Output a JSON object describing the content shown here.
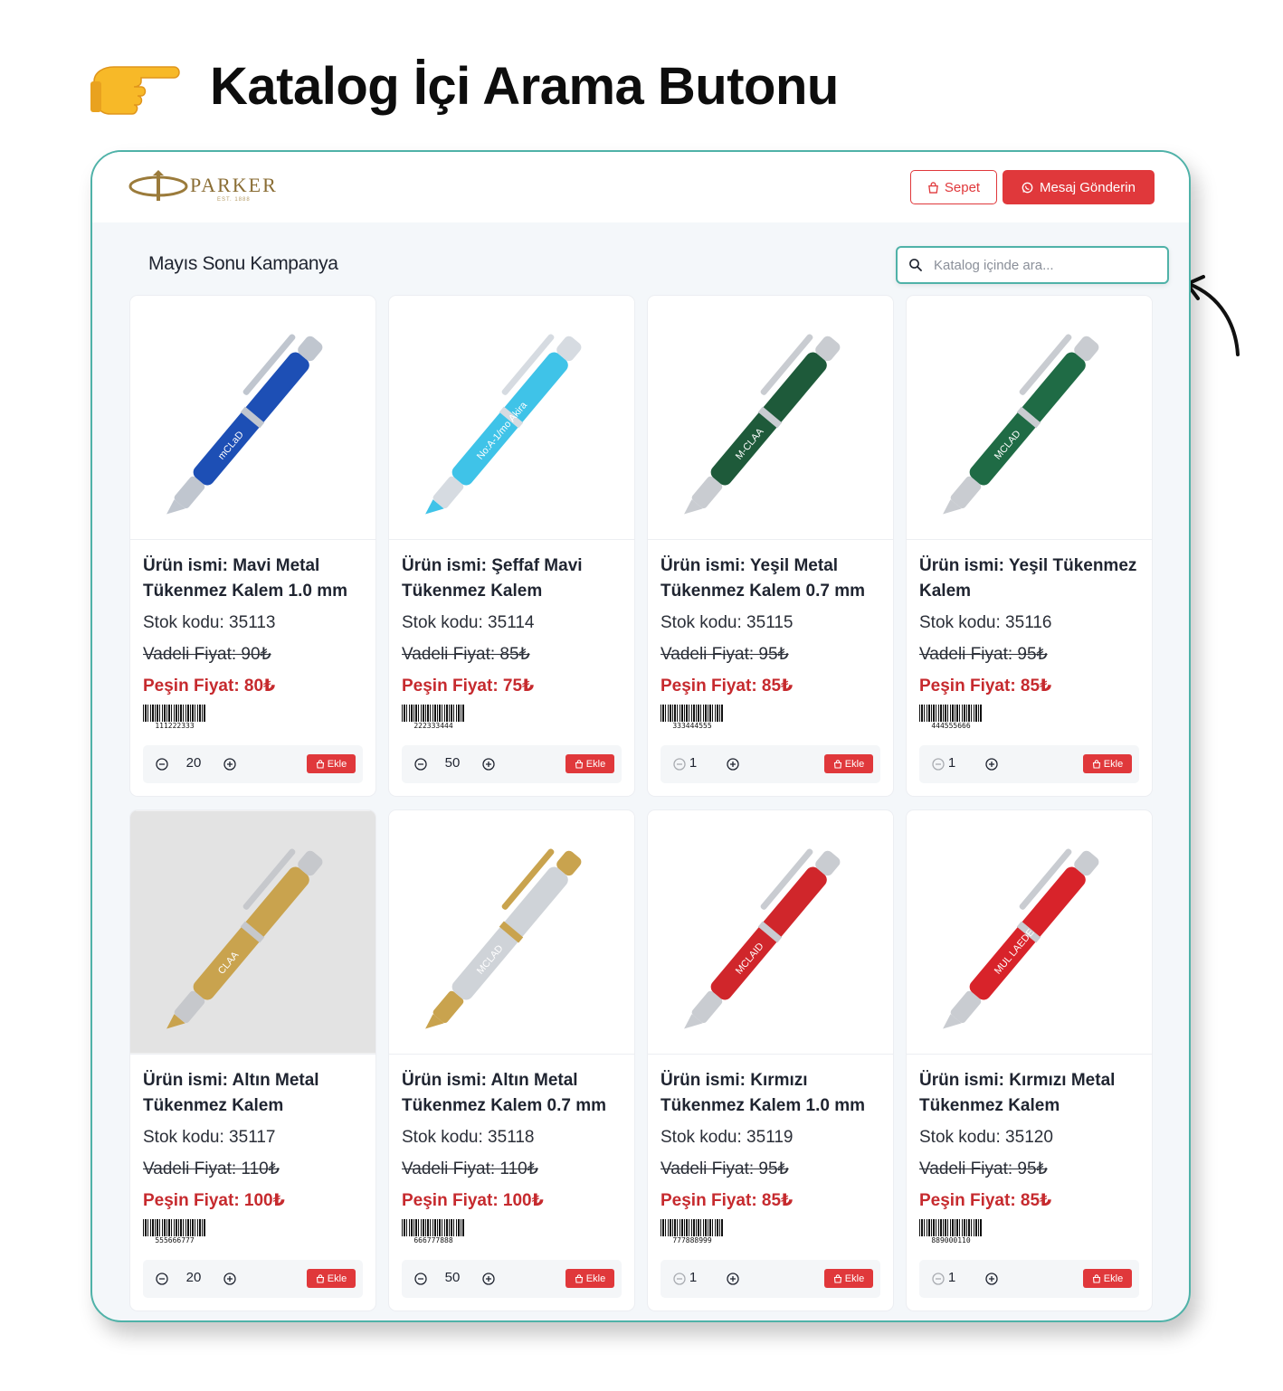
{
  "headline": {
    "icon": "pointing-hand-icon",
    "text": "Katalog İçi Arama Butonu"
  },
  "annotation_arrow": {
    "icon": "curved-arrow-icon"
  },
  "header": {
    "logo_text": "PARKER",
    "logo_sub": "EST. 1888",
    "cart_label": "Sepet",
    "cart_icon": "shopping-bag-icon",
    "message_label": "Mesaj Gönderin",
    "message_icon": "whatsapp-icon"
  },
  "catalog": {
    "title": "Mayıs Sonu Kampanya",
    "search_placeholder": "Katalog içinde ara...",
    "add_label": "Ekle"
  },
  "colors": {
    "accent": "#e0383b",
    "frame": "#4fb2a8",
    "cash_price": "#c62a2e",
    "background": "#f4f7fa"
  },
  "products": [
    {
      "name": "Ürün ismi: Mavi Metal Tükenmez Kalem 1.0 mm",
      "code": "Stok kodu: 35113",
      "term_price": "Vadeli Fiyat: 90₺",
      "cash_price": "Peşin Fiyat: 80₺",
      "barcode": "111222333",
      "qty": "20",
      "qty_min": false,
      "pen": {
        "body": "#1d4fb5",
        "accent": "#c0c6cf",
        "tip": "#c0c6cf",
        "bg": "#ffffff",
        "engraving": "mCLaD"
      }
    },
    {
      "name": "Ürün ismi: Şeffaf Mavi Tükenmez Kalem",
      "code": "Stok kodu: 35114",
      "term_price": "Vadeli Fiyat: 85₺",
      "cash_price": "Peşin Fiyat: 75₺",
      "barcode": "222333444",
      "qty": "50",
      "qty_min": false,
      "pen": {
        "body": "#3fc3e8",
        "accent": "#d6dbe1",
        "tip": "#3fc3e8",
        "bg": "#ffffff",
        "engraving": "No:A-1/mo Akira"
      }
    },
    {
      "name": "Ürün ismi: Yeşil Metal Tükenmez Kalem 0.7 mm",
      "code": "Stok kodu: 35115",
      "term_price": "Vadeli Fiyat: 95₺",
      "cash_price": "Peşin Fiyat: 85₺",
      "barcode": "333444555",
      "qty": "1",
      "qty_min": true,
      "pen": {
        "body": "#1e5a3a",
        "accent": "#c9ccd1",
        "tip": "#c9ccd1",
        "bg": "#ffffff",
        "engraving": "M-CLAA"
      }
    },
    {
      "name": "Ürün ismi: Yeşil Tükenmez Kalem",
      "code": "Stok kodu: 35116",
      "term_price": "Vadeli Fiyat: 95₺",
      "cash_price": "Peşin Fiyat: 85₺",
      "barcode": "444555666",
      "qty": "1",
      "qty_min": true,
      "pen": {
        "body": "#1f6b45",
        "accent": "#c9ccd1",
        "tip": "#c9ccd1",
        "bg": "#ffffff",
        "engraving": "MCLAD"
      }
    },
    {
      "name": "Ürün ismi: Altın Metal Tükenmez Kalem",
      "code": "Stok kodu: 35117",
      "term_price": "Vadeli Fiyat: 110₺",
      "cash_price": "Peşin Fiyat: 100₺",
      "barcode": "555666777",
      "qty": "20",
      "qty_min": false,
      "pen": {
        "body": "#c9a34e",
        "accent": "#c6c8cc",
        "tip": "#c9a34e",
        "bg": "#e3e3e3",
        "engraving": "CLAA"
      }
    },
    {
      "name": "Ürün ismi: Altın Metal Tükenmez Kalem 0.7 mm",
      "code": "Stok kodu: 35118",
      "term_price": "Vadeli Fiyat: 110₺",
      "cash_price": "Peşin Fiyat: 100₺",
      "barcode": "666777888",
      "qty": "50",
      "qty_min": false,
      "pen": {
        "body": "#cfd3d8",
        "accent": "#c9a34e",
        "tip": "#c9a34e",
        "bg": "#ffffff",
        "engraving": "MCLAD"
      }
    },
    {
      "name": "Ürün ismi: Kırmızı Tükenmez Kalem 1.0 mm",
      "code": "Stok kodu: 35119",
      "term_price": "Vadeli Fiyat: 95₺",
      "cash_price": "Peşin Fiyat: 85₺",
      "barcode": "777888999",
      "qty": "1",
      "qty_min": true,
      "pen": {
        "body": "#d0262b",
        "accent": "#c9ccd1",
        "tip": "#c9ccd1",
        "bg": "#ffffff",
        "engraving": "MCLAID"
      }
    },
    {
      "name": "Ürün ismi: Kırmızı Metal Tükenmez Kalem",
      "code": "Stok kodu: 35120",
      "term_price": "Vadeli Fiyat: 95₺",
      "cash_price": "Peşin Fiyat: 85₺",
      "barcode": "889000110",
      "qty": "1",
      "qty_min": true,
      "pen": {
        "body": "#d8232a",
        "accent": "#c9ccd1",
        "tip": "#c9ccd1",
        "bg": "#ffffff",
        "engraving": "MUL LAEDE"
      }
    }
  ]
}
